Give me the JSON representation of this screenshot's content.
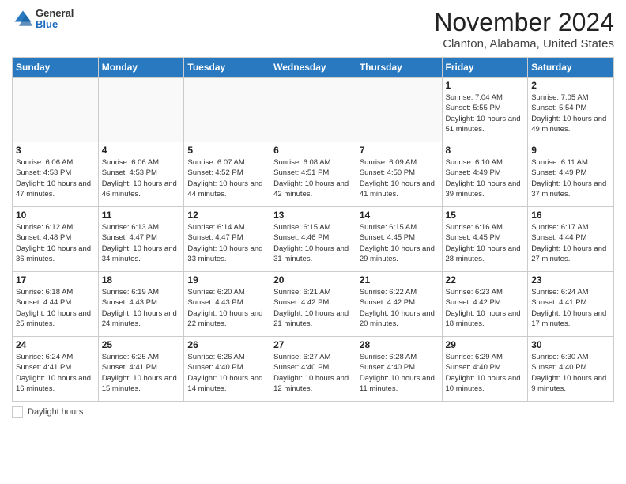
{
  "header": {
    "logo_general": "General",
    "logo_blue": "Blue",
    "month_title": "November 2024",
    "location": "Clanton, Alabama, United States"
  },
  "footer": {
    "daylight_label": "Daylight hours"
  },
  "weekdays": [
    "Sunday",
    "Monday",
    "Tuesday",
    "Wednesday",
    "Thursday",
    "Friday",
    "Saturday"
  ],
  "weeks": [
    [
      {
        "day": "",
        "info": ""
      },
      {
        "day": "",
        "info": ""
      },
      {
        "day": "",
        "info": ""
      },
      {
        "day": "",
        "info": ""
      },
      {
        "day": "",
        "info": ""
      },
      {
        "day": "1",
        "info": "Sunrise: 7:04 AM\nSunset: 5:55 PM\nDaylight: 10 hours and 51 minutes."
      },
      {
        "day": "2",
        "info": "Sunrise: 7:05 AM\nSunset: 5:54 PM\nDaylight: 10 hours and 49 minutes."
      }
    ],
    [
      {
        "day": "3",
        "info": "Sunrise: 6:06 AM\nSunset: 4:53 PM\nDaylight: 10 hours and 47 minutes."
      },
      {
        "day": "4",
        "info": "Sunrise: 6:06 AM\nSunset: 4:53 PM\nDaylight: 10 hours and 46 minutes."
      },
      {
        "day": "5",
        "info": "Sunrise: 6:07 AM\nSunset: 4:52 PM\nDaylight: 10 hours and 44 minutes."
      },
      {
        "day": "6",
        "info": "Sunrise: 6:08 AM\nSunset: 4:51 PM\nDaylight: 10 hours and 42 minutes."
      },
      {
        "day": "7",
        "info": "Sunrise: 6:09 AM\nSunset: 4:50 PM\nDaylight: 10 hours and 41 minutes."
      },
      {
        "day": "8",
        "info": "Sunrise: 6:10 AM\nSunset: 4:49 PM\nDaylight: 10 hours and 39 minutes."
      },
      {
        "day": "9",
        "info": "Sunrise: 6:11 AM\nSunset: 4:49 PM\nDaylight: 10 hours and 37 minutes."
      }
    ],
    [
      {
        "day": "10",
        "info": "Sunrise: 6:12 AM\nSunset: 4:48 PM\nDaylight: 10 hours and 36 minutes."
      },
      {
        "day": "11",
        "info": "Sunrise: 6:13 AM\nSunset: 4:47 PM\nDaylight: 10 hours and 34 minutes."
      },
      {
        "day": "12",
        "info": "Sunrise: 6:14 AM\nSunset: 4:47 PM\nDaylight: 10 hours and 33 minutes."
      },
      {
        "day": "13",
        "info": "Sunrise: 6:15 AM\nSunset: 4:46 PM\nDaylight: 10 hours and 31 minutes."
      },
      {
        "day": "14",
        "info": "Sunrise: 6:15 AM\nSunset: 4:45 PM\nDaylight: 10 hours and 29 minutes."
      },
      {
        "day": "15",
        "info": "Sunrise: 6:16 AM\nSunset: 4:45 PM\nDaylight: 10 hours and 28 minutes."
      },
      {
        "day": "16",
        "info": "Sunrise: 6:17 AM\nSunset: 4:44 PM\nDaylight: 10 hours and 27 minutes."
      }
    ],
    [
      {
        "day": "17",
        "info": "Sunrise: 6:18 AM\nSunset: 4:44 PM\nDaylight: 10 hours and 25 minutes."
      },
      {
        "day": "18",
        "info": "Sunrise: 6:19 AM\nSunset: 4:43 PM\nDaylight: 10 hours and 24 minutes."
      },
      {
        "day": "19",
        "info": "Sunrise: 6:20 AM\nSunset: 4:43 PM\nDaylight: 10 hours and 22 minutes."
      },
      {
        "day": "20",
        "info": "Sunrise: 6:21 AM\nSunset: 4:42 PM\nDaylight: 10 hours and 21 minutes."
      },
      {
        "day": "21",
        "info": "Sunrise: 6:22 AM\nSunset: 4:42 PM\nDaylight: 10 hours and 20 minutes."
      },
      {
        "day": "22",
        "info": "Sunrise: 6:23 AM\nSunset: 4:42 PM\nDaylight: 10 hours and 18 minutes."
      },
      {
        "day": "23",
        "info": "Sunrise: 6:24 AM\nSunset: 4:41 PM\nDaylight: 10 hours and 17 minutes."
      }
    ],
    [
      {
        "day": "24",
        "info": "Sunrise: 6:24 AM\nSunset: 4:41 PM\nDaylight: 10 hours and 16 minutes."
      },
      {
        "day": "25",
        "info": "Sunrise: 6:25 AM\nSunset: 4:41 PM\nDaylight: 10 hours and 15 minutes."
      },
      {
        "day": "26",
        "info": "Sunrise: 6:26 AM\nSunset: 4:40 PM\nDaylight: 10 hours and 14 minutes."
      },
      {
        "day": "27",
        "info": "Sunrise: 6:27 AM\nSunset: 4:40 PM\nDaylight: 10 hours and 12 minutes."
      },
      {
        "day": "28",
        "info": "Sunrise: 6:28 AM\nSunset: 4:40 PM\nDaylight: 10 hours and 11 minutes."
      },
      {
        "day": "29",
        "info": "Sunrise: 6:29 AM\nSunset: 4:40 PM\nDaylight: 10 hours and 10 minutes."
      },
      {
        "day": "30",
        "info": "Sunrise: 6:30 AM\nSunset: 4:40 PM\nDaylight: 10 hours and 9 minutes."
      }
    ]
  ]
}
